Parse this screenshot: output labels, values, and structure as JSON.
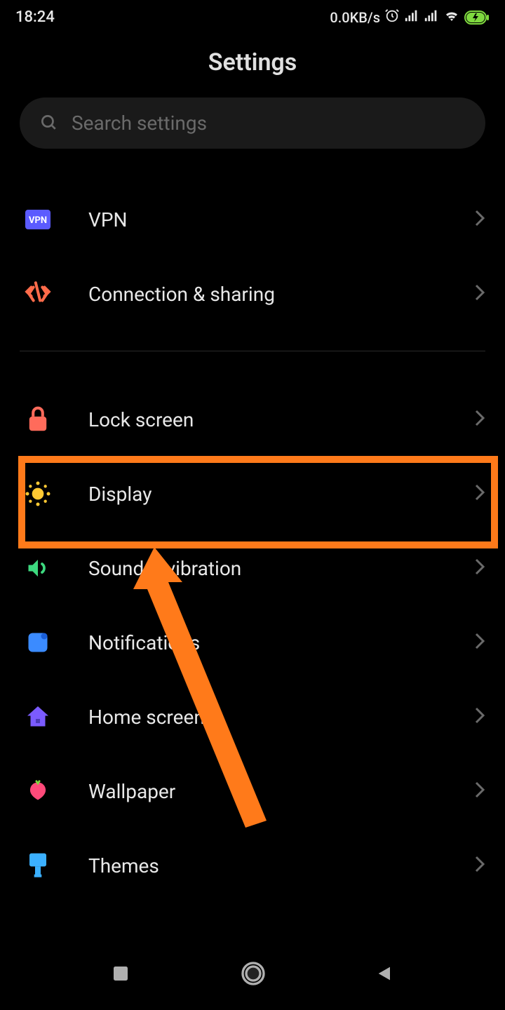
{
  "status_bar": {
    "time": "18:24",
    "network_speed": "0.0KB/s"
  },
  "page_title": "Settings",
  "search": {
    "placeholder": "Search settings"
  },
  "items": [
    {
      "label": "VPN",
      "icon": "vpn"
    },
    {
      "label": "Connection & sharing",
      "icon": "connection"
    },
    {
      "label": "Lock screen",
      "icon": "lock"
    },
    {
      "label": "Display",
      "icon": "sun"
    },
    {
      "label": "Sound & vibration",
      "icon": "sound"
    },
    {
      "label": "Notifications",
      "icon": "notifications"
    },
    {
      "label": "Home screen",
      "icon": "home"
    },
    {
      "label": "Wallpaper",
      "icon": "wallpaper"
    },
    {
      "label": "Themes",
      "icon": "themes"
    }
  ],
  "highlight": {
    "target": "Display"
  }
}
